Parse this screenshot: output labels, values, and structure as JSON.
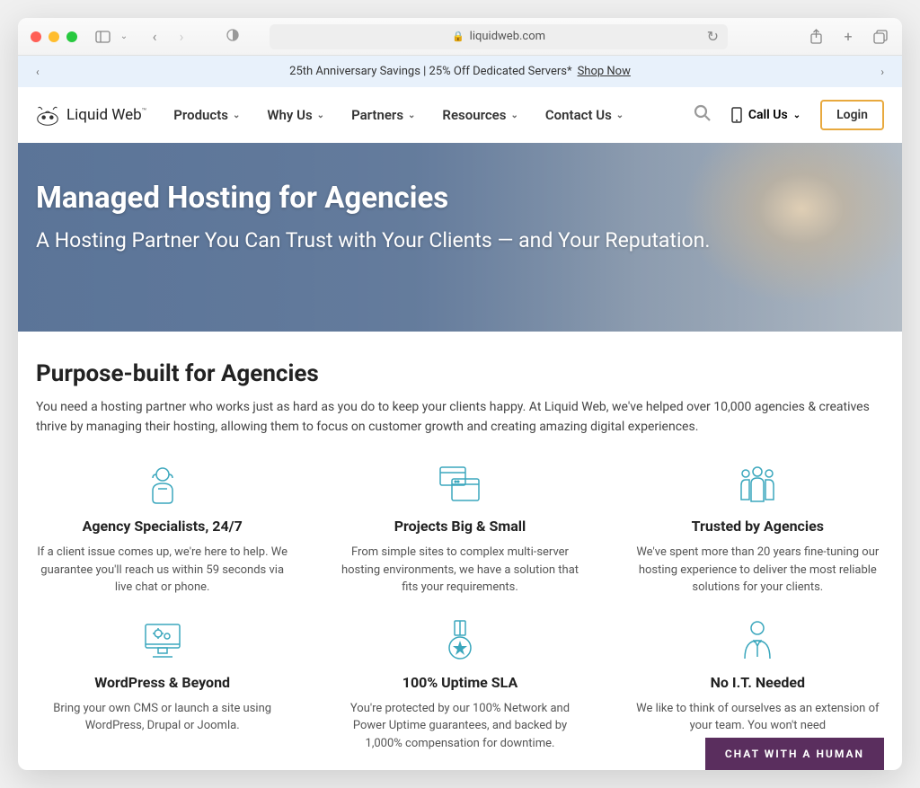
{
  "browser": {
    "url": "liquidweb.com"
  },
  "promo": {
    "text": "25th Anniversary Savings | 25% Off Dedicated Servers*",
    "link": "Shop Now"
  },
  "logo": {
    "text": "Liquid Web",
    "tm": "™"
  },
  "nav": {
    "items": [
      "Products",
      "Why Us",
      "Partners",
      "Resources",
      "Contact Us"
    ],
    "call": "Call Us",
    "login": "Login"
  },
  "hero": {
    "title": "Managed Hosting for Agencies",
    "subtitle": "A Hosting Partner You Can Trust with Your Clients — and Your Reputation."
  },
  "section": {
    "title": "Purpose-built for Agencies",
    "desc": "You need a hosting partner who works just as hard as you do to keep your clients happy. At Liquid Web, we've helped over 10,000 agencies & creatives thrive by managing their hosting, allowing them to focus on customer growth and creating amazing digital experiences."
  },
  "features": [
    {
      "title": "Agency Specialists, 24/7",
      "desc": "If a client issue comes up, we're here to help. We guarantee you'll reach us within 59 seconds via live chat or phone."
    },
    {
      "title": "Projects Big & Small",
      "desc": "From simple sites to complex multi-server hosting environments, we have a solution that fits your requirements."
    },
    {
      "title": "Trusted by Agencies",
      "desc": "We've spent more than 20 years fine-tuning our hosting experience to deliver the most reliable solutions for your clients."
    },
    {
      "title": "WordPress & Beyond",
      "desc": "Bring your own CMS or launch a site using WordPress, Drupal or Joomla."
    },
    {
      "title": "100% Uptime SLA",
      "desc": "You're protected by our 100% Network and Power Uptime guarantees, and backed by 1,000% compensation for downtime."
    },
    {
      "title": "No I.T. Needed",
      "desc": "We like to think of ourselves as an extension of your team. You won't need"
    }
  ],
  "chat": {
    "label": "CHAT WITH A HUMAN"
  }
}
